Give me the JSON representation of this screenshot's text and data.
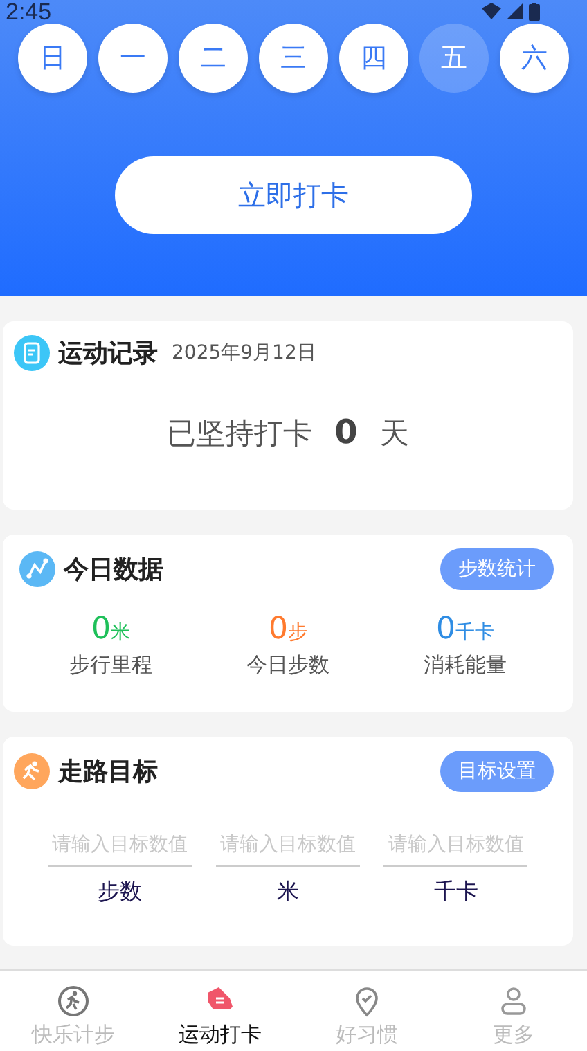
{
  "status_bar": {
    "time": "2:45"
  },
  "days": [
    {
      "label": "日",
      "selected": false
    },
    {
      "label": "一",
      "selected": false
    },
    {
      "label": "二",
      "selected": false
    },
    {
      "label": "三",
      "selected": false
    },
    {
      "label": "四",
      "selected": false
    },
    {
      "label": "五",
      "selected": true
    },
    {
      "label": "六",
      "selected": false
    }
  ],
  "checkin_button": "立即打卡",
  "record": {
    "title": "运动记录",
    "date": "2025年9月12日",
    "prefix": "已坚持打卡",
    "days": "0",
    "suffix": "天"
  },
  "today": {
    "title": "今日数据",
    "button": "步数统计",
    "metrics": [
      {
        "value": "0",
        "unit": "米",
        "label": "步行里程",
        "color": "#1fc05a"
      },
      {
        "value": "0",
        "unit": "步",
        "label": "今日步数",
        "color": "#ff7a2e"
      },
      {
        "value": "0",
        "unit": "千卡",
        "label": "消耗能量",
        "color": "#2f8de4"
      }
    ]
  },
  "goal": {
    "title": "走路目标",
    "button": "目标设置",
    "fields": [
      {
        "placeholder": "请输入目标数值",
        "unit": "步数"
      },
      {
        "placeholder": "请输入目标数值",
        "unit": "米"
      },
      {
        "placeholder": "请输入目标数值",
        "unit": "千卡"
      }
    ]
  },
  "tabs": [
    {
      "label": "快乐计步",
      "selected": false
    },
    {
      "label": "运动打卡",
      "selected": true
    },
    {
      "label": "好习惯",
      "selected": false
    },
    {
      "label": "更多",
      "selected": false
    }
  ]
}
